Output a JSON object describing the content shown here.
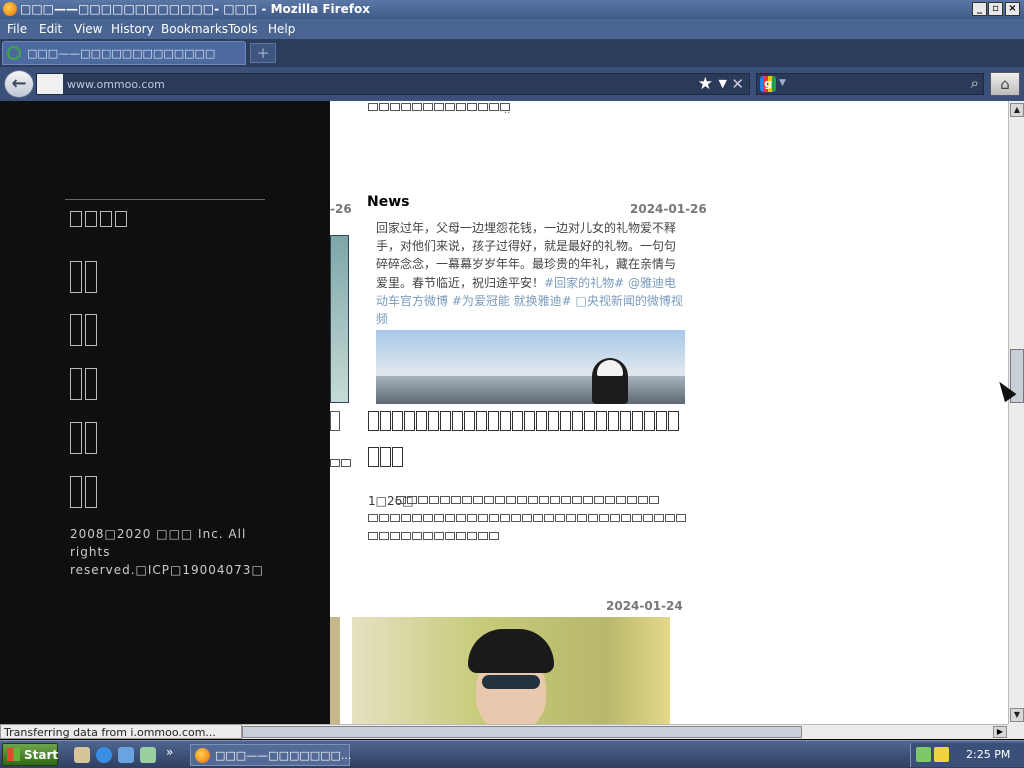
{
  "window": {
    "title": "□□□——□□□□□□□□□□□□- □□□ - Mozilla Firefox"
  },
  "menu": [
    "File",
    "Edit",
    "View",
    "History",
    "Bookmarks",
    "Tools",
    "Help"
  ],
  "tab": {
    "label": "□□□——□□□□□□□□□□□□□"
  },
  "address": {
    "url": "www.ommoo.com"
  },
  "sidebar": {
    "copyright": "2008□2020 □□□ Inc. All rights reserved.□ICP□19004073□"
  },
  "content": {
    "news": {
      "heading": "News",
      "date": "2024-01-26",
      "body": "回家过年，父母一边埋怨花钱，一边对儿女的礼物爱不释手，对他们来说，孩子过得好，就是最好的礼物。一句句碎碎念念，一幕幕岁岁年年。最珍贵的年礼，藏在亲情与爱里。春节临近，祝归途平安！",
      "tags": "#回家的礼物# @雅迪电动车官方微博 #为爱冠能 就换雅迪# □央视新闻的微博视频",
      "post_text": "1□26□"
    },
    "partial_date": "-26",
    "second_date": "2024-01-24",
    "top_snippet": ".."
  },
  "status": {
    "text": "Transferring data from i.ommoo.com..."
  },
  "taskbar": {
    "start_label": "Start",
    "task_label": "□□□——□□□□□□□...",
    "clock": "2:25 PM"
  }
}
